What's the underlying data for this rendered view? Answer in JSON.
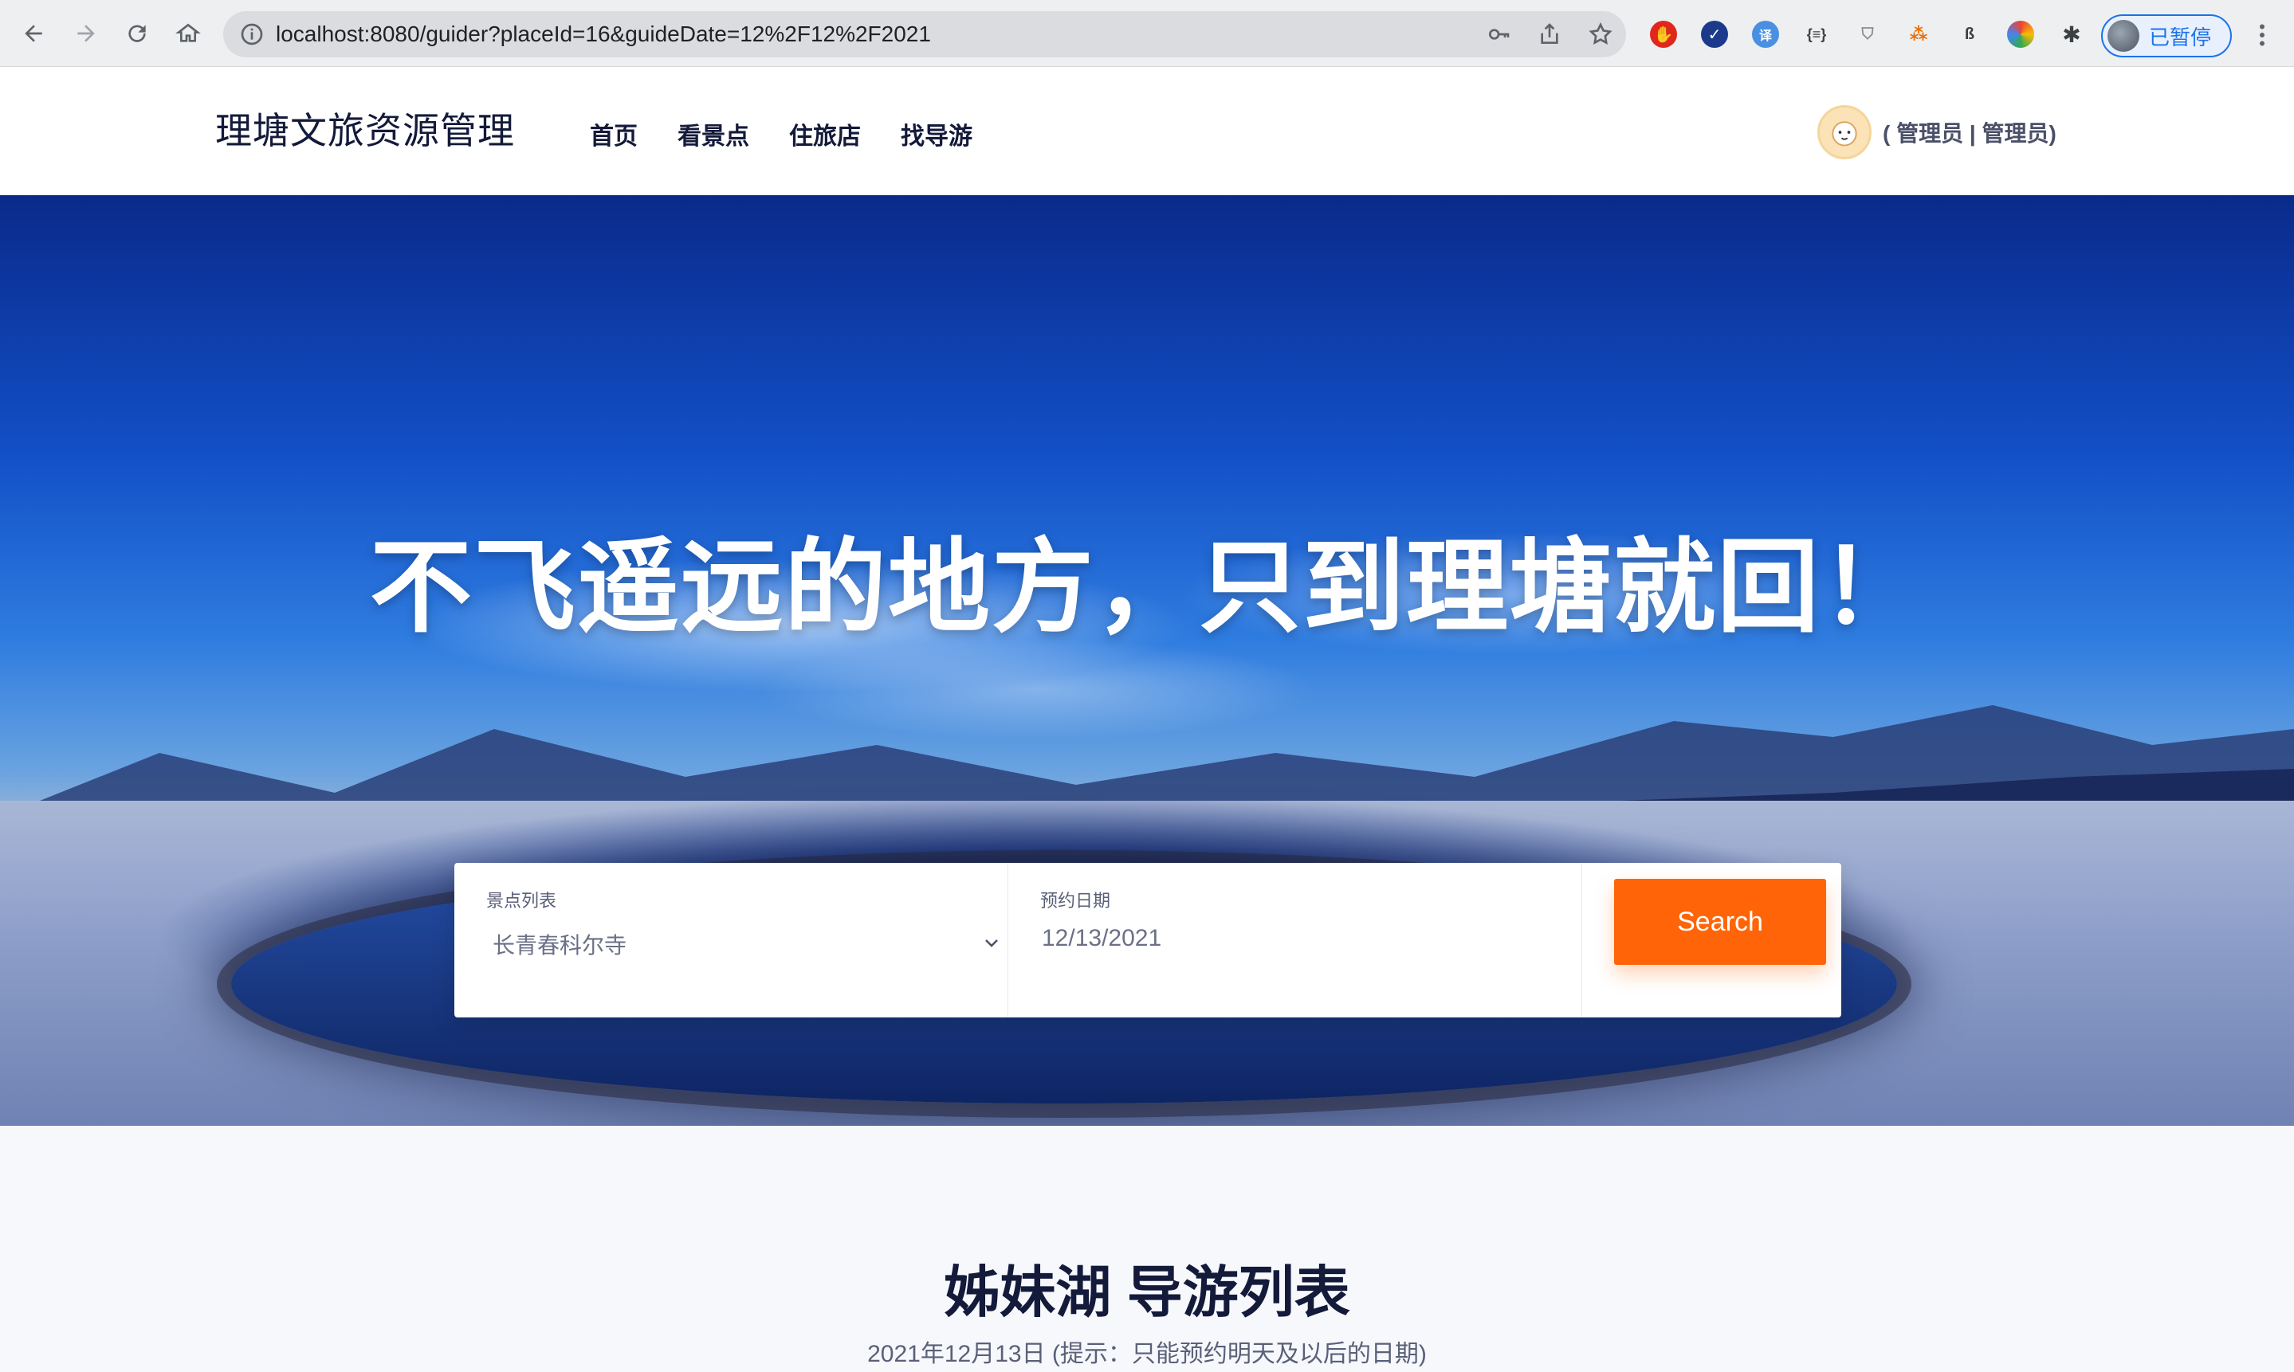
{
  "browser": {
    "url": "localhost:8080/guider?placeId=16&guideDate=12%2F12%2F2021",
    "profile_status": "已暂停"
  },
  "header": {
    "brand": "理塘文旅资源管理",
    "menu": [
      {
        "label": "首页"
      },
      {
        "label": "看景点"
      },
      {
        "label": "住旅店"
      },
      {
        "label": "找导游"
      }
    ],
    "user_label": "( 管理员 | 管理员)"
  },
  "hero": {
    "title": "不飞遥远的地方，只到理塘就回！"
  },
  "search": {
    "place_label": "景点列表",
    "place_value": "长青春科尔寺",
    "date_label": "预约日期",
    "date_value": "12/13/2021",
    "button_label": "Search"
  },
  "section": {
    "title": "姊妹湖 导游列表",
    "subtitle": "2021年12月13日 (提示：只能预约明天及以后的日期)"
  },
  "colors": {
    "accent": "#ff6508",
    "chrome_blue": "#1a73e8",
    "heading": "#131a3a"
  }
}
